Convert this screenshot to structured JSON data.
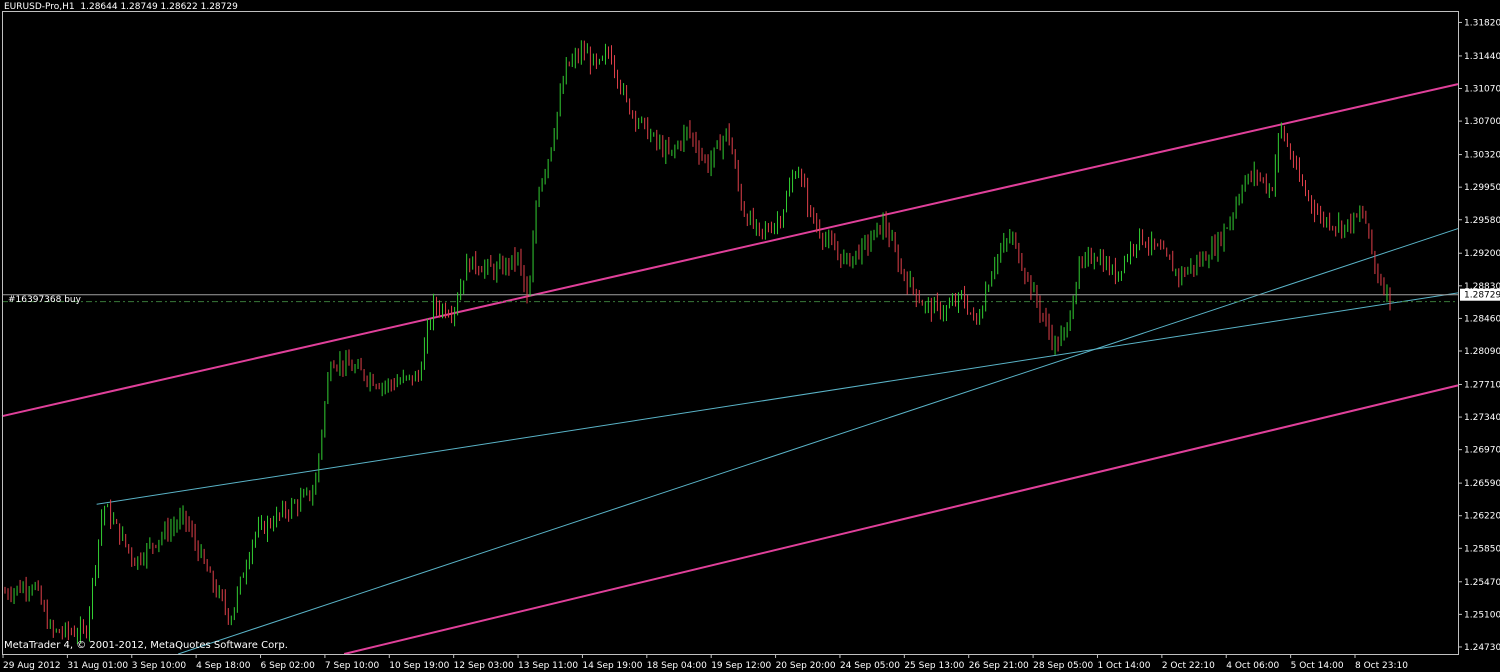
{
  "header": {
    "symbol": "EURUSD-Pro,H1",
    "ohlc": "1.28644 1.28749 1.28622 1.28729"
  },
  "order_label": "#16397368 buy",
  "copyright": "MetaTrader 4, © 2001-2012, MetaQuotes Software Corp.",
  "current_price": "1.28729",
  "colors": {
    "background": "#000000",
    "bull": "#32cd32",
    "bear": "#e0404a",
    "channel": "#e0409a",
    "trendline": "#5ab4c8",
    "grid_frame": "#c0c0c0",
    "order_line": "#3a7a3a",
    "text": "#ffffff"
  },
  "chart_data": {
    "type": "candlestick",
    "timeframe": "H1",
    "ylim": [
      1.2465,
      1.3195
    ],
    "y_ticks": [
      "1.31820",
      "1.31440",
      "1.31070",
      "1.30700",
      "1.30320",
      "1.29950",
      "1.29580",
      "1.29200",
      "1.28830",
      "1.28460",
      "1.28090",
      "1.27710",
      "1.27340",
      "1.26970",
      "1.26590",
      "1.26220",
      "1.25850",
      "1.25470",
      "1.25100",
      "1.24730"
    ],
    "x_ticks": [
      "29 Aug 2012",
      "31 Aug 01:00",
      "3 Sep 10:00",
      "4 Sep 18:00",
      "6 Sep 02:00",
      "7 Sep 10:00",
      "10 Sep 19:00",
      "12 Sep 03:00",
      "13 Sep 11:00",
      "14 Sep 19:00",
      "18 Sep 04:00",
      "19 Sep 12:00",
      "20 Sep 20:00",
      "24 Sep 05:00",
      "25 Sep 13:00",
      "26 Sep 21:00",
      "28 Sep 05:00",
      "1 Oct 14:00",
      "2 Oct 22:10",
      "4 Oct 06:00",
      "5 Oct 14:00",
      "8 Oct 23:10"
    ],
    "price_path": [
      [
        0,
        1.2535
      ],
      [
        0.02,
        1.2545
      ],
      [
        0.032,
        1.249
      ],
      [
        0.056,
        1.249
      ],
      [
        0.068,
        1.2635
      ],
      [
        0.09,
        1.257
      ],
      [
        0.108,
        1.26
      ],
      [
        0.124,
        1.262
      ],
      [
        0.142,
        1.255
      ],
      [
        0.156,
        1.2505
      ],
      [
        0.172,
        1.26
      ],
      [
        0.196,
        1.263
      ],
      [
        0.214,
        1.265
      ],
      [
        0.225,
        1.28
      ],
      [
        0.24,
        1.279
      ],
      [
        0.262,
        1.277
      ],
      [
        0.286,
        1.278
      ],
      [
        0.296,
        1.286
      ],
      [
        0.31,
        1.2855
      ],
      [
        0.32,
        1.291
      ],
      [
        0.34,
        1.29
      ],
      [
        0.355,
        1.2915
      ],
      [
        0.362,
        1.286
      ],
      [
        0.368,
        1.299
      ],
      [
        0.376,
        1.303
      ],
      [
        0.388,
        1.313
      ],
      [
        0.4,
        1.315
      ],
      [
        0.41,
        1.313
      ],
      [
        0.418,
        1.315
      ],
      [
        0.43,
        1.309
      ],
      [
        0.448,
        1.305
      ],
      [
        0.46,
        1.303
      ],
      [
        0.472,
        1.306
      ],
      [
        0.486,
        1.302
      ],
      [
        0.5,
        1.306
      ],
      [
        0.51,
        1.297
      ],
      [
        0.522,
        1.294
      ],
      [
        0.536,
        1.296
      ],
      [
        0.548,
        1.302
      ],
      [
        0.558,
        1.296
      ],
      [
        0.57,
        1.293
      ],
      [
        0.582,
        1.291
      ],
      [
        0.596,
        1.293
      ],
      [
        0.608,
        1.2955
      ],
      [
        0.62,
        1.29
      ],
      [
        0.636,
        1.286
      ],
      [
        0.65,
        1.2855
      ],
      [
        0.662,
        1.287
      ],
      [
        0.672,
        1.284
      ],
      [
        0.684,
        1.291
      ],
      [
        0.696,
        1.294
      ],
      [
        0.71,
        1.288
      ],
      [
        0.726,
        1.2815
      ],
      [
        0.734,
        1.283
      ],
      [
        0.742,
        1.29
      ],
      [
        0.754,
        1.292
      ],
      [
        0.768,
        1.2895
      ],
      [
        0.784,
        1.294
      ],
      [
        0.8,
        1.292
      ],
      [
        0.812,
        1.2895
      ],
      [
        0.826,
        1.291
      ],
      [
        0.838,
        1.293
      ],
      [
        0.848,
        1.296
      ],
      [
        0.856,
        1.3
      ],
      [
        0.866,
        1.301
      ],
      [
        0.876,
        1.299
      ],
      [
        0.882,
        1.3065
      ],
      [
        0.896,
        1.3
      ],
      [
        0.91,
        1.296
      ],
      [
        0.926,
        1.295
      ],
      [
        0.94,
        1.2965
      ],
      [
        0.948,
        1.29
      ],
      [
        0.958,
        1.287
      ]
    ],
    "lines": {
      "channel_upper": {
        "from": [
          0,
          1.2735
        ],
        "to": [
          1,
          1.3112
        ]
      },
      "channel_lower": {
        "from": [
          0.235,
          1.2465
        ],
        "to": [
          1,
          1.277
        ]
      },
      "trend_support": {
        "from": [
          0.121,
          1.2465
        ],
        "to": [
          1,
          1.2948
        ]
      },
      "trend_fan": {
        "from": [
          0.065,
          1.2635
        ],
        "to": [
          1,
          1.2875
        ]
      },
      "order_line": 1.2865,
      "current_price_line": 1.28729
    }
  }
}
